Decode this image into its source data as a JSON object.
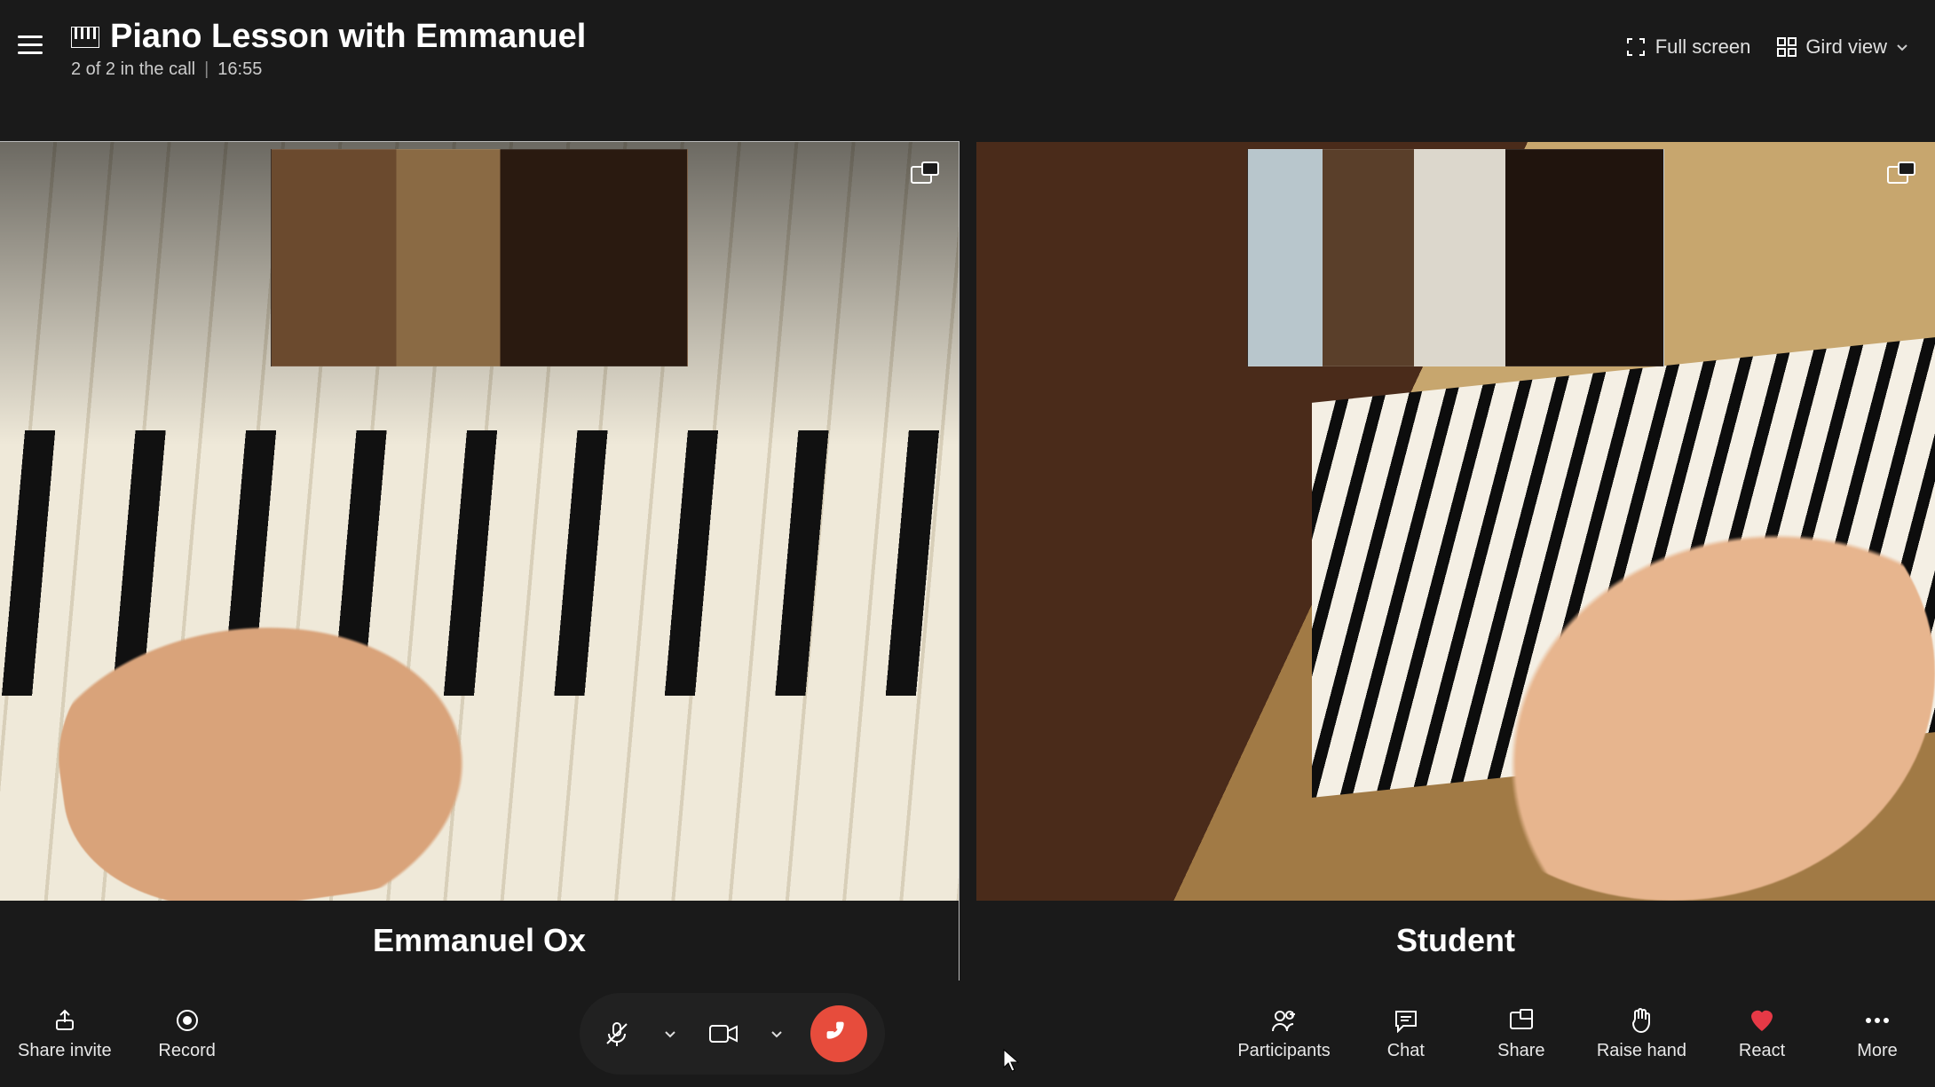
{
  "header": {
    "title": "Piano Lesson with Emmanuel",
    "participants_status": "2 of 2 in the call",
    "call_duration": "16:55",
    "fullscreen_label": "Full screen",
    "view_label": "Gird view",
    "icon": "piano-icon"
  },
  "tiles": [
    {
      "name": "Emmanuel Ox",
      "active": true,
      "pip": true,
      "popout": true
    },
    {
      "name": "Student",
      "active": false,
      "pip": true,
      "popout": true
    }
  ],
  "center_controls": {
    "mic": {
      "state": "muted",
      "icon": "mic-off-icon"
    },
    "mic_menu": {
      "icon": "chevron-down-icon"
    },
    "camera": {
      "state": "on",
      "icon": "video-icon"
    },
    "camera_menu": {
      "icon": "chevron-down-icon"
    },
    "hangup": {
      "icon": "hangup-icon",
      "color": "#e74c3c"
    }
  },
  "bottom_left": [
    {
      "id": "share-invite",
      "label": "Share invite",
      "icon": "share-up-icon"
    },
    {
      "id": "record",
      "label": "Record",
      "icon": "record-icon"
    }
  ],
  "bottom_right": [
    {
      "id": "participants",
      "label": "Participants",
      "icon": "people-icon"
    },
    {
      "id": "chat",
      "label": "Chat",
      "icon": "chat-icon"
    },
    {
      "id": "share",
      "label": "Share",
      "icon": "screen-share-icon"
    },
    {
      "id": "raise-hand",
      "label": "Raise hand",
      "icon": "raise-hand-icon"
    },
    {
      "id": "react",
      "label": "React",
      "icon": "heart-icon",
      "accent": true
    },
    {
      "id": "more",
      "label": "More",
      "icon": "more-icon"
    }
  ],
  "colors": {
    "background": "#1a1a1a",
    "text": "#ffffff",
    "subtext": "#cccccc",
    "hangup": "#e74c3c",
    "react_heart": "#e63946"
  }
}
